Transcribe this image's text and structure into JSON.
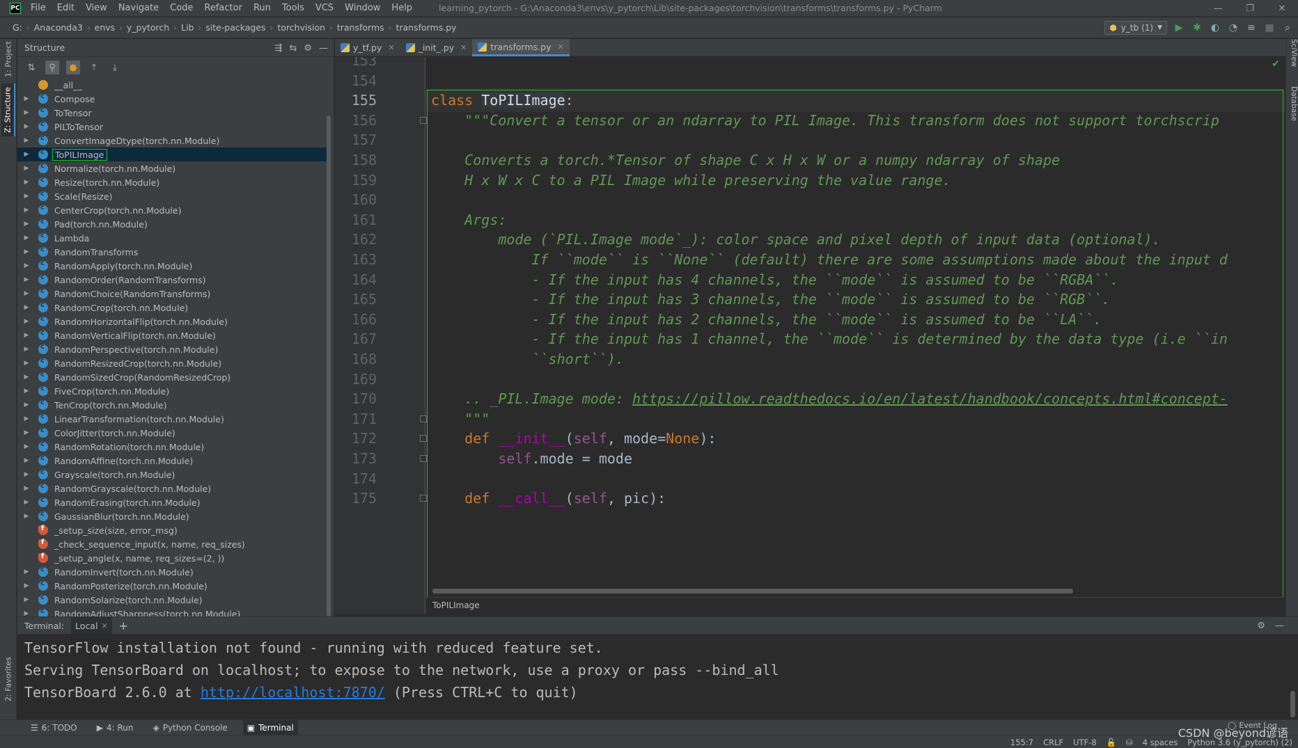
{
  "app": {
    "logo_text": "PC",
    "menu": [
      "File",
      "Edit",
      "View",
      "Navigate",
      "Code",
      "Refactor",
      "Run",
      "Tools",
      "VCS",
      "Window",
      "Help"
    ],
    "window_title": "learning_pytorch - G:\\Anaconda3\\envs\\y_pytorch\\Lib\\site-packages\\torchvision\\transforms\\transforms.py - PyCharm",
    "window_controls": [
      "—",
      "❐",
      "✕"
    ]
  },
  "breadcrumb": [
    "G:",
    "Anaconda3",
    "envs",
    "y_pytorch",
    "Lib",
    "site-packages",
    "torchvision",
    "transforms",
    "transforms.py"
  ],
  "run_toolbar": {
    "config_name": "y_tb (1)"
  },
  "left_stripe": {
    "project_tab": "1: Project",
    "structure_tab": "Z: Structure",
    "favorites_tab": "2: Favorites"
  },
  "structure": {
    "title": "Structure",
    "items": [
      {
        "label": "__all__",
        "kind": "var",
        "expandable": false
      },
      {
        "label": "Compose",
        "kind": "class",
        "expandable": true
      },
      {
        "label": "ToTensor",
        "kind": "class",
        "expandable": true
      },
      {
        "label": "PILToTensor",
        "kind": "class",
        "expandable": true
      },
      {
        "label": "ConvertImageDtype(torch.nn.Module)",
        "kind": "class",
        "expandable": true
      },
      {
        "label": "ToPILImage",
        "kind": "class",
        "expandable": true,
        "selected": true
      },
      {
        "label": "Normalize(torch.nn.Module)",
        "kind": "class",
        "expandable": true
      },
      {
        "label": "Resize(torch.nn.Module)",
        "kind": "class",
        "expandable": true
      },
      {
        "label": "Scale(Resize)",
        "kind": "class",
        "expandable": true
      },
      {
        "label": "CenterCrop(torch.nn.Module)",
        "kind": "class",
        "expandable": true
      },
      {
        "label": "Pad(torch.nn.Module)",
        "kind": "class",
        "expandable": true
      },
      {
        "label": "Lambda",
        "kind": "class",
        "expandable": true
      },
      {
        "label": "RandomTransforms",
        "kind": "class",
        "expandable": true
      },
      {
        "label": "RandomApply(torch.nn.Module)",
        "kind": "class",
        "expandable": true
      },
      {
        "label": "RandomOrder(RandomTransforms)",
        "kind": "class",
        "expandable": true
      },
      {
        "label": "RandomChoice(RandomTransforms)",
        "kind": "class",
        "expandable": true
      },
      {
        "label": "RandomCrop(torch.nn.Module)",
        "kind": "class",
        "expandable": true
      },
      {
        "label": "RandomHorizontalFlip(torch.nn.Module)",
        "kind": "class",
        "expandable": true
      },
      {
        "label": "RandomVerticalFlip(torch.nn.Module)",
        "kind": "class",
        "expandable": true
      },
      {
        "label": "RandomPerspective(torch.nn.Module)",
        "kind": "class",
        "expandable": true
      },
      {
        "label": "RandomResizedCrop(torch.nn.Module)",
        "kind": "class",
        "expandable": true
      },
      {
        "label": "RandomSizedCrop(RandomResizedCrop)",
        "kind": "class",
        "expandable": true
      },
      {
        "label": "FiveCrop(torch.nn.Module)",
        "kind": "class",
        "expandable": true
      },
      {
        "label": "TenCrop(torch.nn.Module)",
        "kind": "class",
        "expandable": true
      },
      {
        "label": "LinearTransformation(torch.nn.Module)",
        "kind": "class",
        "expandable": true
      },
      {
        "label": "ColorJitter(torch.nn.Module)",
        "kind": "class",
        "expandable": true
      },
      {
        "label": "RandomRotation(torch.nn.Module)",
        "kind": "class",
        "expandable": true
      },
      {
        "label": "RandomAffine(torch.nn.Module)",
        "kind": "class",
        "expandable": true
      },
      {
        "label": "Grayscale(torch.nn.Module)",
        "kind": "class",
        "expandable": true
      },
      {
        "label": "RandomGrayscale(torch.nn.Module)",
        "kind": "class",
        "expandable": true
      },
      {
        "label": "RandomErasing(torch.nn.Module)",
        "kind": "class",
        "expandable": true
      },
      {
        "label": "GaussianBlur(torch.nn.Module)",
        "kind": "class",
        "expandable": true
      },
      {
        "label": "_setup_size(size, error_msg)",
        "kind": "func",
        "expandable": false
      },
      {
        "label": "_check_sequence_input(x, name, req_sizes)",
        "kind": "func",
        "expandable": false
      },
      {
        "label": "_setup_angle(x, name, req_sizes=(2, ))",
        "kind": "func",
        "expandable": false
      },
      {
        "label": "RandomInvert(torch.nn.Module)",
        "kind": "class",
        "expandable": true
      },
      {
        "label": "RandomPosterize(torch.nn.Module)",
        "kind": "class",
        "expandable": true
      },
      {
        "label": "RandomSolarize(torch.nn.Module)",
        "kind": "class",
        "expandable": true
      },
      {
        "label": "RandomAdjustSharpness(torch.nn.Module)",
        "kind": "class",
        "expandable": true
      }
    ]
  },
  "editor_tabs": [
    {
      "label": "y_tf.py",
      "active": false
    },
    {
      "label": "_init_.py",
      "active": false
    },
    {
      "label": "transforms.py",
      "active": true
    }
  ],
  "editor": {
    "lines": [
      {
        "num": "153",
        "tokens": []
      },
      {
        "num": "154",
        "tokens": []
      },
      {
        "num": "155",
        "current": true,
        "tokens": [
          [
            "kw",
            "class "
          ],
          [
            "cls",
            "ToPILImage"
          ],
          [
            "plain",
            ":"
          ]
        ]
      },
      {
        "num": "156",
        "fold": true,
        "tokens": [
          [
            "doc",
            "    \"\"\"Convert a tensor or an ndarray to PIL Image. This transform does not support torchscrip"
          ]
        ]
      },
      {
        "num": "157",
        "tokens": []
      },
      {
        "num": "158",
        "tokens": [
          [
            "doc",
            "    Converts a torch.*Tensor of shape C x H x W or a numpy ndarray of shape"
          ]
        ]
      },
      {
        "num": "159",
        "tokens": [
          [
            "doc",
            "    H x W x C to a PIL Image while preserving the value range."
          ]
        ]
      },
      {
        "num": "160",
        "tokens": []
      },
      {
        "num": "161",
        "tokens": [
          [
            "doc",
            "    Args:"
          ]
        ]
      },
      {
        "num": "162",
        "tokens": [
          [
            "doc",
            "        mode (`PIL.Image mode`_): color space and pixel depth of input data (optional)."
          ]
        ]
      },
      {
        "num": "163",
        "tokens": [
          [
            "doc",
            "            If ``mode`` is ``None`` (default) there are some assumptions made about the input d"
          ]
        ]
      },
      {
        "num": "164",
        "tokens": [
          [
            "doc",
            "            - If the input has 4 channels, the ``mode`` is assumed to be ``RGBA``."
          ]
        ]
      },
      {
        "num": "165",
        "tokens": [
          [
            "doc",
            "            - If the input has 3 channels, the ``mode`` is assumed to be ``RGB``."
          ]
        ]
      },
      {
        "num": "166",
        "tokens": [
          [
            "doc",
            "            - If the input has 2 channels, the ``mode`` is assumed to be ``LA``."
          ]
        ]
      },
      {
        "num": "167",
        "tokens": [
          [
            "doc",
            "            - If the input has 1 channel, the ``mode`` is determined by the data type (i.e ``in"
          ]
        ]
      },
      {
        "num": "168",
        "tokens": [
          [
            "doc",
            "            ``short``)."
          ]
        ]
      },
      {
        "num": "169",
        "tokens": []
      },
      {
        "num": "170",
        "tokens": [
          [
            "doc",
            "    .. _PIL.Image mode: "
          ],
          [
            "doclink",
            "https://pillow.readthedocs.io/en/latest/handbook/concepts.html#concept-"
          ]
        ]
      },
      {
        "num": "171",
        "fold": true,
        "tokens": [
          [
            "doc",
            "    \"\"\""
          ]
        ]
      },
      {
        "num": "172",
        "fold": true,
        "tokens": [
          [
            "kw",
            "    def "
          ],
          [
            "fn",
            "__init__"
          ],
          [
            "plain",
            "("
          ],
          [
            "selfkw",
            "self"
          ],
          [
            "plain",
            ", mode="
          ],
          [
            "nonekw",
            "None"
          ],
          [
            "plain",
            "):"
          ]
        ]
      },
      {
        "num": "173",
        "fold": true,
        "tokens": [
          [
            "selfkw",
            "        self"
          ],
          [
            "plain",
            ".mode = mode"
          ]
        ]
      },
      {
        "num": "174",
        "tokens": []
      },
      {
        "num": "175",
        "fold": true,
        "tokens": [
          [
            "kw",
            "    def "
          ],
          [
            "fn",
            "__call__"
          ],
          [
            "plain",
            "("
          ],
          [
            "selfkw",
            "self"
          ],
          [
            "plain",
            ", pic):"
          ]
        ]
      }
    ],
    "breadcrumb": "ToPILImage"
  },
  "right_stripe": {
    "sciview": "SciView",
    "database": "Database"
  },
  "terminal": {
    "label": "Terminal:",
    "tab": "Local",
    "lines": [
      {
        "text": "TensorFlow installation not found - running with reduced feature set."
      },
      {
        "text": "Serving TensorBoard on localhost; to expose to the network, use a proxy or pass --bind_all"
      },
      {
        "prefix": "TensorBoard 2.6.0 at ",
        "link": "http://localhost:7870/",
        "suffix": " (Press CTRL+C to quit)"
      }
    ]
  },
  "bottom_tools": [
    {
      "label": "6: TODO",
      "icon": "☰"
    },
    {
      "label": "4: Run",
      "icon": "▶"
    },
    {
      "label": "Python Console",
      "icon": "◈"
    },
    {
      "label": "Terminal",
      "icon": "▣",
      "active": true
    }
  ],
  "status": {
    "position": "155:7",
    "line_sep": "CRLF",
    "encoding": "UTF-8",
    "indent": "4 spaces",
    "interpreter": "Python 3.6 (y_pytorch) (2)",
    "event_log": "Event Log"
  },
  "watermark": "CSDN @beyond谚语"
}
